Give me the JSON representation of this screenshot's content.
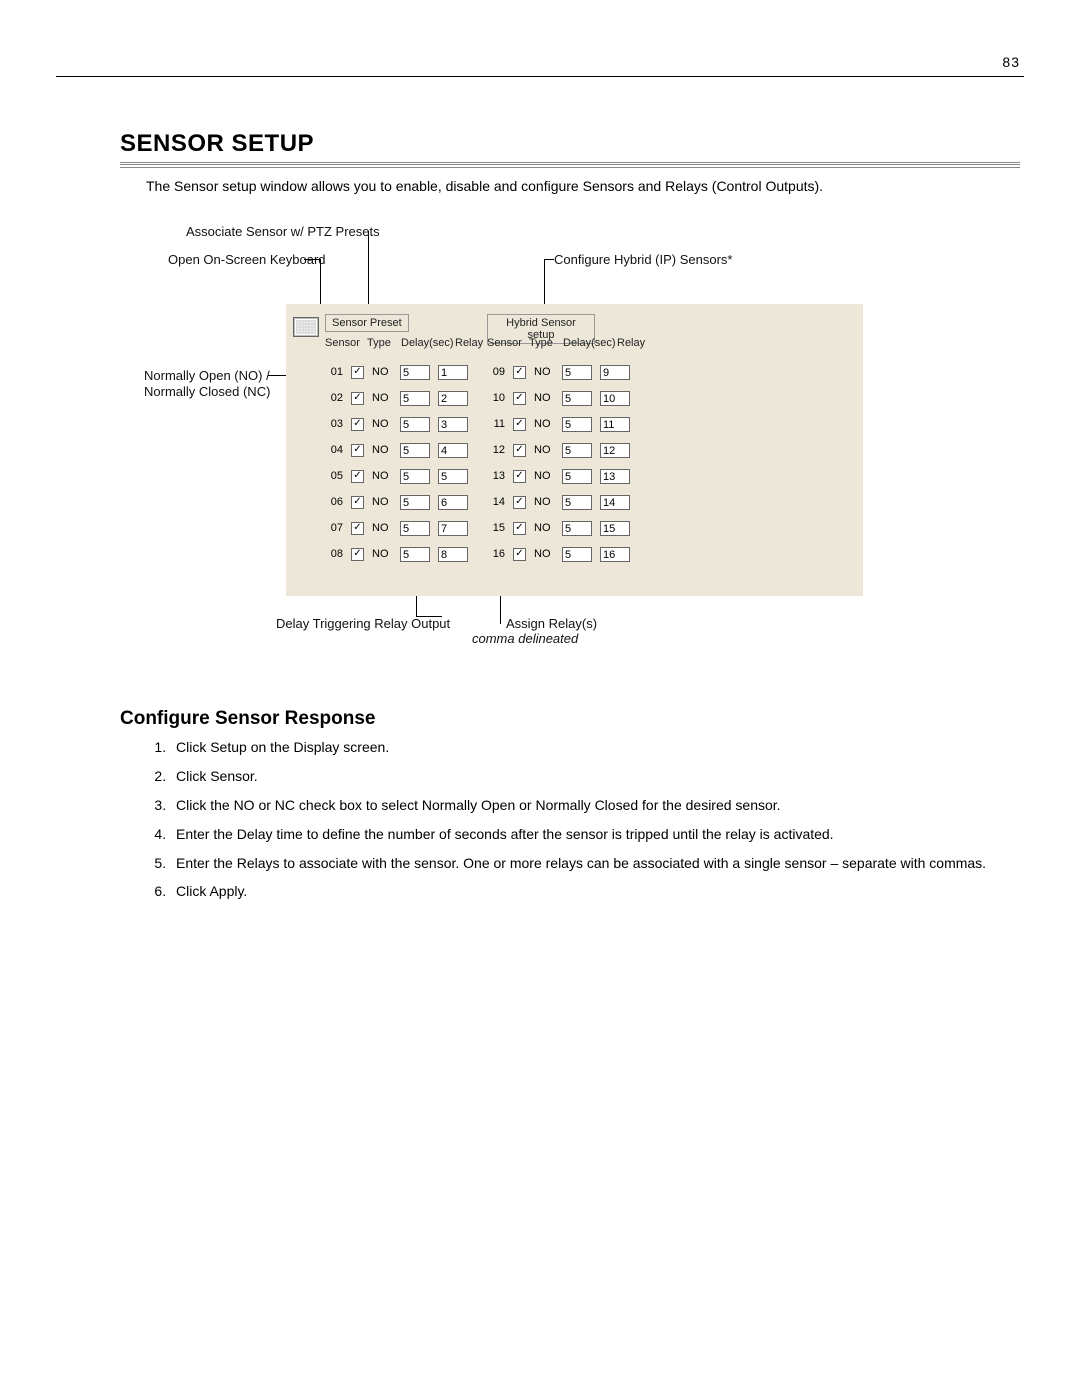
{
  "page_number": "83",
  "title": "SENSOR SETUP",
  "intro": "The Sensor setup window allows you to enable, disable and configure Sensors and Relays (Control Outputs).",
  "callouts": {
    "ptz": "Associate Sensor w/ PTZ Presets",
    "keyboard": "Open On-Screen Keyboard",
    "hybrid": "Configure Hybrid (IP) Sensors*",
    "no_nc_1": "Normally Open (NO) /",
    "no_nc_2": "Normally Closed (NC)",
    "delay_out": "Delay Triggering Relay Output",
    "assign_relay": "Assign Relay(s)",
    "comma": "comma delineated"
  },
  "panel": {
    "sensor_preset_btn": "Sensor Preset",
    "hybrid_btn": "Hybrid Sensor setup",
    "headers": {
      "sensor": "Sensor",
      "type": "Type",
      "delay": "Delay(sec)",
      "relay": "Relay"
    },
    "left_rows": [
      {
        "id": "01",
        "checked": true,
        "type": "NO",
        "delay": "5",
        "relay": "1"
      },
      {
        "id": "02",
        "checked": true,
        "type": "NO",
        "delay": "5",
        "relay": "2"
      },
      {
        "id": "03",
        "checked": true,
        "type": "NO",
        "delay": "5",
        "relay": "3"
      },
      {
        "id": "04",
        "checked": true,
        "type": "NO",
        "delay": "5",
        "relay": "4"
      },
      {
        "id": "05",
        "checked": true,
        "type": "NO",
        "delay": "5",
        "relay": "5"
      },
      {
        "id": "06",
        "checked": true,
        "type": "NO",
        "delay": "5",
        "relay": "6"
      },
      {
        "id": "07",
        "checked": true,
        "type": "NO",
        "delay": "5",
        "relay": "7"
      },
      {
        "id": "08",
        "checked": true,
        "type": "NO",
        "delay": "5",
        "relay": "8"
      }
    ],
    "right_rows": [
      {
        "id": "09",
        "checked": true,
        "type": "NO",
        "delay": "5",
        "relay": "9"
      },
      {
        "id": "10",
        "checked": true,
        "type": "NO",
        "delay": "5",
        "relay": "10"
      },
      {
        "id": "11",
        "checked": true,
        "type": "NO",
        "delay": "5",
        "relay": "11"
      },
      {
        "id": "12",
        "checked": true,
        "type": "NO",
        "delay": "5",
        "relay": "12"
      },
      {
        "id": "13",
        "checked": true,
        "type": "NO",
        "delay": "5",
        "relay": "13"
      },
      {
        "id": "14",
        "checked": true,
        "type": "NO",
        "delay": "5",
        "relay": "14"
      },
      {
        "id": "15",
        "checked": true,
        "type": "NO",
        "delay": "5",
        "relay": "15"
      },
      {
        "id": "16",
        "checked": true,
        "type": "NO",
        "delay": "5",
        "relay": "16"
      }
    ]
  },
  "section_title": "Configure Sensor Response",
  "steps": [
    "Click Setup on the Display screen.",
    "Click Sensor.",
    "Click the NO or NC check box to select Normally Open or Normally Closed for the desired sensor.",
    "Enter the Delay time to define the number of seconds after the sensor is tripped until the relay is activated.",
    "Enter the Relays to associate with the sensor. One or more relays can be associated with a single sensor – separate with commas.",
    "Click Apply."
  ]
}
